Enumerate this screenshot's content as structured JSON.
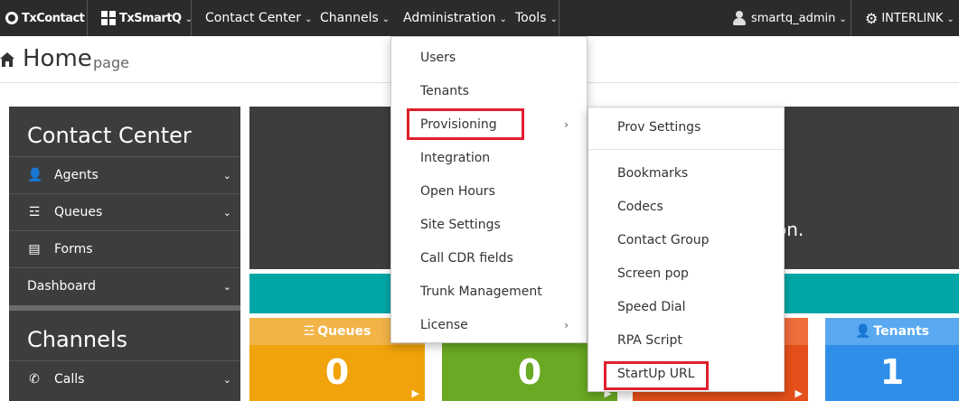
{
  "navbar": {
    "brand": "TxContact",
    "smartq": "TxSmartQ",
    "items": [
      {
        "label": "Contact Center"
      },
      {
        "label": "Channels"
      },
      {
        "label": "Administration"
      },
      {
        "label": "Tools"
      }
    ],
    "user": "smartq_admin",
    "tenant": "INTERLINK"
  },
  "header": {
    "title": "Home",
    "subtitle": "page"
  },
  "sidebar": {
    "heading1": "Contact Center",
    "items": [
      {
        "label": "Agents",
        "icon": "user-icon"
      },
      {
        "label": "Queues",
        "icon": "database-icon"
      },
      {
        "label": "Forms",
        "icon": "clipboard-icon"
      },
      {
        "label": "Dashboard",
        "icon": ""
      }
    ],
    "heading2": "Channels",
    "items2": [
      {
        "label": "Calls",
        "icon": "phone-icon"
      }
    ]
  },
  "main": {
    "partial_text": "on.",
    "tiles": [
      {
        "label": "Queues",
        "value": "0",
        "color": "#f0a30a",
        "head_color": "#f2b447"
      },
      {
        "label": "",
        "value": "0",
        "color": "#6aa923",
        "head_color": "#6aa923"
      },
      {
        "label": "",
        "value": "",
        "color": "#e5501a",
        "head_color": "#ef6c3b"
      },
      {
        "label": "Tenants",
        "value": "1",
        "color": "#2f8fe8",
        "head_color": "#5aa9f0"
      }
    ]
  },
  "admin_menu": {
    "items": [
      {
        "label": "Users"
      },
      {
        "label": "Tenants"
      },
      {
        "label": "Provisioning"
      },
      {
        "label": "Integration"
      },
      {
        "label": "Open Hours"
      },
      {
        "label": "Site Settings"
      },
      {
        "label": "Call CDR fields"
      },
      {
        "label": "Trunk Management"
      },
      {
        "label": "License"
      }
    ]
  },
  "provisioning_menu": {
    "items": [
      {
        "label": "Prov Settings"
      },
      {
        "label": "Bookmarks"
      },
      {
        "label": "Codecs"
      },
      {
        "label": "Contact Group"
      },
      {
        "label": "Screen pop"
      },
      {
        "label": "Speed Dial"
      },
      {
        "label": "RPA Script"
      },
      {
        "label": "StartUp URL"
      }
    ]
  },
  "colors": {
    "navbar": "#2b2b2b",
    "sidebar": "#3d3d3d",
    "teal": "#00a6a6",
    "highlight": "#e0202d"
  }
}
